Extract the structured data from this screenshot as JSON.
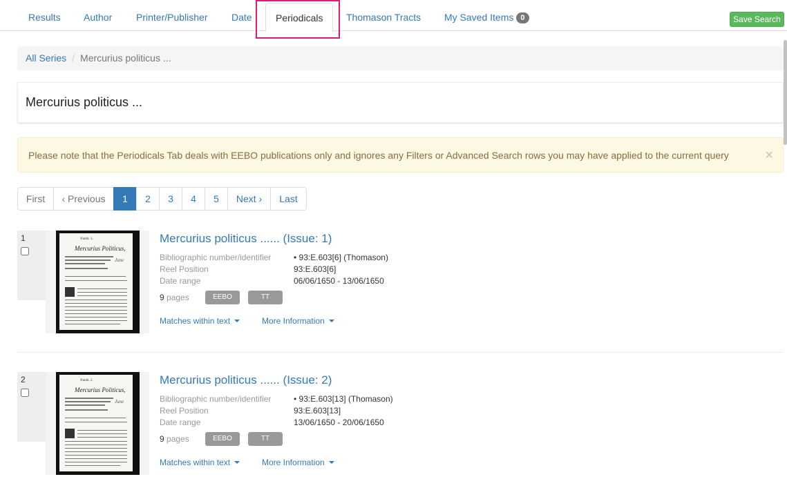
{
  "tabs": [
    {
      "label": "Results",
      "active": false
    },
    {
      "label": "Author",
      "active": false
    },
    {
      "label": "Printer/Publisher",
      "active": false
    },
    {
      "label": "Date",
      "active": false
    },
    {
      "label": "Periodicals",
      "active": true
    },
    {
      "label": "Thomason Tracts",
      "active": false
    },
    {
      "label": "My Saved Items",
      "active": false,
      "badge": "0"
    }
  ],
  "save_search_label": "Save Search",
  "breadcrumb": {
    "root": "All Series",
    "separator": "/",
    "current": "Mercurius politicus ..."
  },
  "page_title": "Mercurius politicus ...",
  "alert": {
    "text": "Please note that the Periodicals Tab deals with EEBO publications only and ignores any Filters or Advanced Search rows you may have applied to the current query",
    "close": "×"
  },
  "pagination": [
    "First",
    "‹ Previous",
    "1",
    "2",
    "3",
    "4",
    "5",
    "Next ›",
    "Last"
  ],
  "pagination_active": "1",
  "meta_labels": {
    "biblio": "Bibliographic number/identifier",
    "reel": "Reel Position",
    "date": "Date range",
    "pages": "pages",
    "matches": "Matches within text",
    "more": "More Information"
  },
  "results": [
    {
      "num": "1",
      "title": "Mercurius politicus ...... (Issue: 1)",
      "biblio": "93:E.603[6] (Thomason)",
      "reel": "93:E.603[6]",
      "date_range": "06/06/1650 - 13/06/1650",
      "pages": "9",
      "tags": [
        "EEBO",
        "TT"
      ],
      "thumb_masthead": "Mercurius Politicus,"
    },
    {
      "num": "2",
      "title": "Mercurius politicus ...... (Issue: 2)",
      "biblio": "93:E.603[13] (Thomason)",
      "reel": "93:E.603[13]",
      "date_range": "13/06/1650 - 20/06/1650",
      "pages": "9",
      "tags": [
        "EEBO",
        "TT"
      ],
      "thumb_masthead": "Mercurius Politicus,"
    }
  ],
  "colors": {
    "link": "#337ab7",
    "active_page": "#337ab7",
    "save_button": "#5cb85c",
    "alert_bg": "#fcf8e3",
    "highlight_border": "#e0197d",
    "tag_bg": "#999999"
  }
}
